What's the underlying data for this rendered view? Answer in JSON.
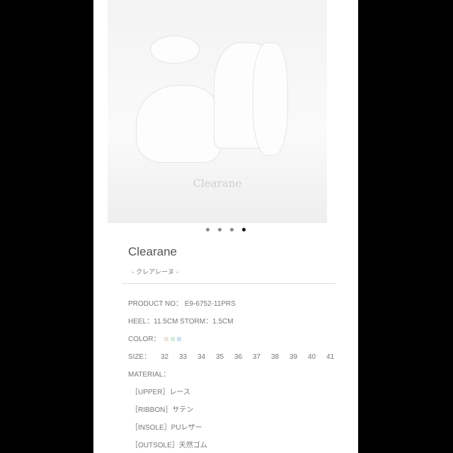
{
  "carousel": {
    "logo_text": "Clearane",
    "pages": 4,
    "active_page": 4
  },
  "product": {
    "name": "Clearane",
    "subtitle": "- クレアレーヌ -",
    "product_no_label": "PRODUCT NO：",
    "product_no": "E9-6752-11PRS",
    "heel": "HEEL：11.5CM STORM：1.5CM",
    "color_label": "COLOR：",
    "colors": [
      "#ece6dc",
      "#d6ecdf",
      "#cfe2f0"
    ],
    "size_label": "SIZE：",
    "sizes": [
      "32",
      "33",
      "34",
      "35",
      "36",
      "37",
      "38",
      "39",
      "40",
      "41"
    ],
    "material_label": "MATERIAL：",
    "materials": [
      "［UPPER］レース",
      "［RIBBON］サテン",
      "［INSOLE］PUレザー",
      "［OUTSOLE］天然ゴム"
    ]
  }
}
